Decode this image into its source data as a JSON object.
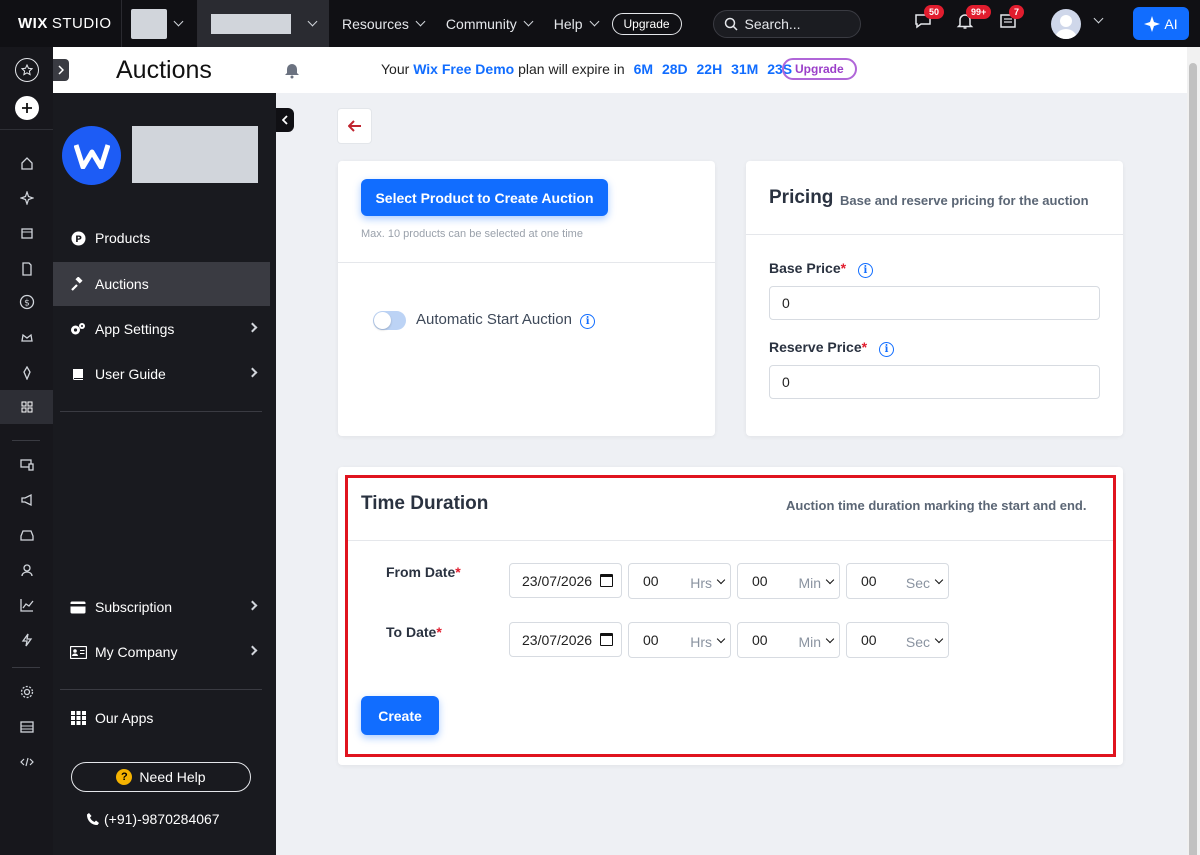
{
  "topbar": {
    "logo_bold": "WIX",
    "logo_light": "STUDIO",
    "nav": [
      "Resources",
      "Community",
      "Help"
    ],
    "upgrade": "Upgrade",
    "search_placeholder": "Search...",
    "badges": {
      "messages": "50",
      "notifications": "99+",
      "updates": "7"
    },
    "ai_label": "AI"
  },
  "app": {
    "title": "Auctions",
    "plan": {
      "prefix": "Your",
      "brand": "Wix Free Demo",
      "middle": "plan will expire in",
      "countdown": [
        "6M",
        "28D",
        "22H",
        "31M",
        "23S"
      ],
      "upgrade": "Upgrade"
    }
  },
  "sidebar": {
    "items": [
      {
        "label": "Products",
        "icon": "products-icon"
      },
      {
        "label": "Auctions",
        "icon": "gavel-icon",
        "active": true
      },
      {
        "label": "App Settings",
        "icon": "gears-icon"
      },
      {
        "label": "User Guide",
        "icon": "book-icon"
      },
      {
        "label": "Subscription",
        "icon": "credit-card-icon"
      },
      {
        "label": "My Company",
        "icon": "id-card-icon"
      },
      {
        "label": "Our Apps",
        "icon": "grid-icon"
      }
    ],
    "need_help": "Need Help",
    "phone": "(+91)-9870284067"
  },
  "product_card": {
    "select_button": "Select Product to Create Auction",
    "hint": "Max. 10 products can be selected at one time",
    "auto_start_label": "Automatic Start Auction",
    "auto_start_enabled": false
  },
  "pricing": {
    "title": "Pricing",
    "subtitle": "Base and reserve pricing for the auction",
    "base_label": "Base Price",
    "base_value": "0",
    "reserve_label": "Reserve Price",
    "reserve_value": "0"
  },
  "time_duration": {
    "title": "Time Duration",
    "subtitle": "Auction time duration marking the start and end.",
    "from_label": "From Date",
    "to_label": "To Date",
    "from_date": "23/07/2026",
    "to_date": "23/07/2026",
    "hours": "00",
    "minutes": "00",
    "seconds": "00",
    "hrs_unit": "Hrs",
    "min_unit": "Min",
    "sec_unit": "Sec",
    "create_button": "Create"
  },
  "colors": {
    "accent": "#116dff",
    "highlight": "#e0141f",
    "sidebar_bg": "#191a1f",
    "topbar_bg": "#101014"
  }
}
